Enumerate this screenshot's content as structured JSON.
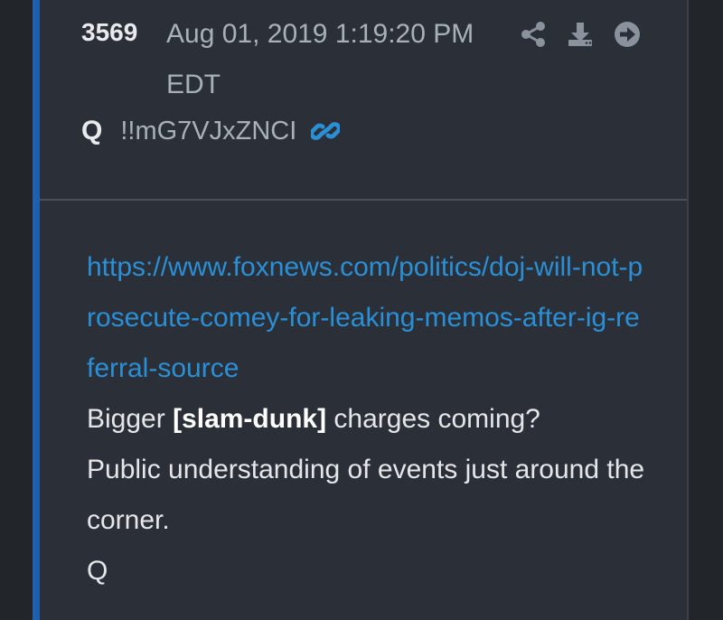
{
  "post": {
    "number": "3569",
    "date": "Aug 01, 2019 1:19:20 PM EDT",
    "author": "Q",
    "tripcode": "!!mG7VJxZNCI",
    "link_url": "https://www.foxnews.com/politics/doj-will-not-prosecute-comey-for-leaking-memos-after-ig-referral-source",
    "line1_before": "Bigger ",
    "line1_bold": "[slam-dunk]",
    "line1_after": " charges coming?",
    "line2": "Public understanding of events just around the corner.",
    "signature": "Q"
  },
  "icons": {
    "share": "share-icon",
    "download": "download-icon",
    "goto": "arrow-circle-right-icon",
    "permalink": "link-icon"
  },
  "colors": {
    "accent_border": "#1f5fae",
    "link": "#2b8fd6",
    "card_bg": "#2b3038",
    "page_bg": "#222529"
  }
}
